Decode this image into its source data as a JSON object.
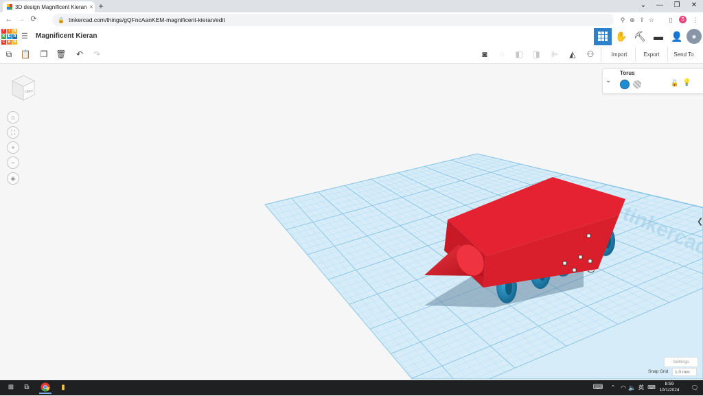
{
  "browser": {
    "tab_title": "3D design Magnificent Kieran",
    "tab_close": "×",
    "new_tab": "+",
    "window_buttons": [
      "⌄",
      "—",
      "❐",
      "✕"
    ],
    "url": "tinkercad.com/things/gQFncAanKEM-magnificent-kieran/edit",
    "nav": [
      "←",
      "→",
      "⟳"
    ],
    "profile_letter": "S"
  },
  "app": {
    "logo_letters": [
      "T",
      "I",
      "N",
      "K",
      "E",
      "R",
      "C",
      "A",
      "D"
    ],
    "logo_colors": [
      "#e4352f",
      "#f08030",
      "#f5b82a",
      "#4aa855",
      "#2c9bd6",
      "#1e6fb5",
      "#e4352f",
      "#f08030",
      "#f5b82a"
    ],
    "design_title": "Magnificent Kieran",
    "accent_color": "#2f80c8"
  },
  "toolbar": {
    "import_label": "Import",
    "export_label": "Export",
    "send_to_label": "Send To"
  },
  "view_cube": {
    "face_label": "LEFT"
  },
  "inspector": {
    "shape_name": "Torus",
    "solid_color": "#1a8fd3"
  },
  "footer": {
    "settings_label": "Settings",
    "snap_grid_label": "Snap Grid",
    "snap_grid_value": "1.0 mm"
  },
  "scene": {
    "body_color": "#dc1f2b",
    "wheel_color": "#1b85b8",
    "grid_color": "#a6d4ee",
    "plate_watermark": "tinkercad"
  },
  "taskbar": {
    "time": "8:59",
    "date": "10/1/2024",
    "ime_label": "英"
  }
}
